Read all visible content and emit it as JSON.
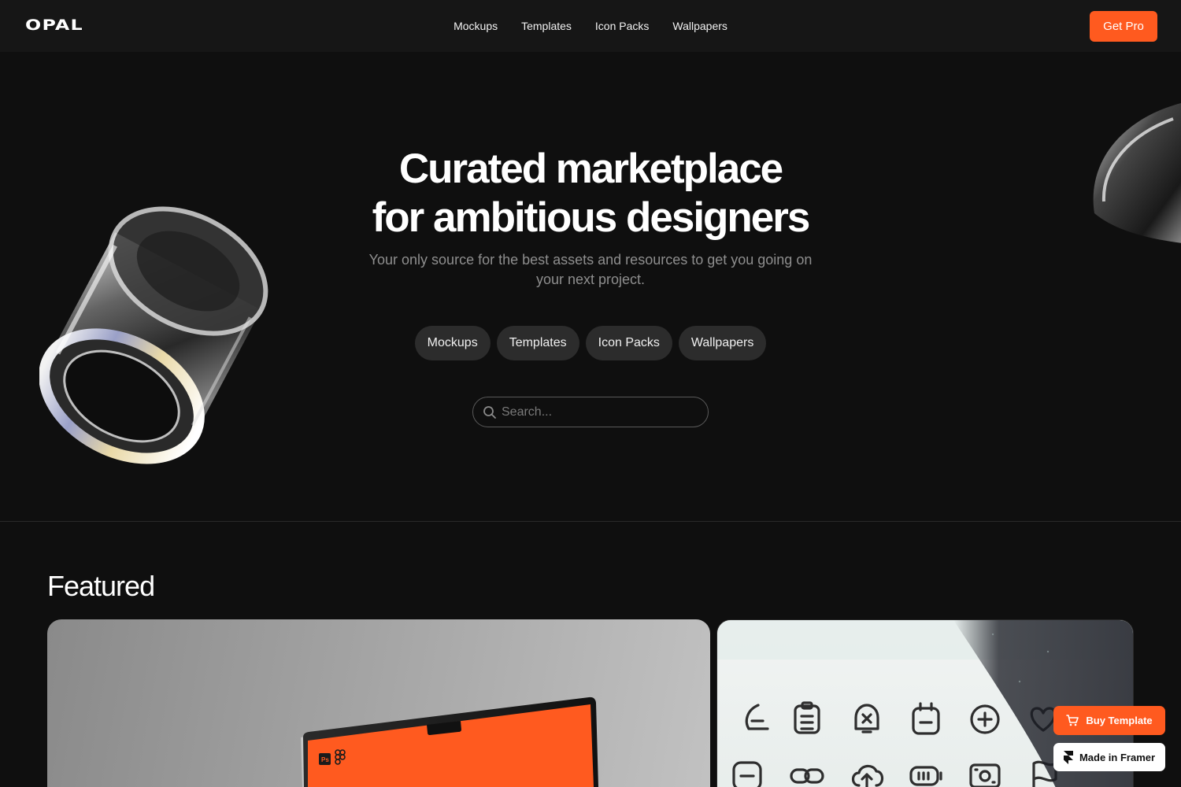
{
  "nav": {
    "logo": "OPAL",
    "links": [
      "Mockups",
      "Templates",
      "Icon Packs",
      "Wallpapers"
    ],
    "cta": "Get Pro"
  },
  "hero": {
    "title_line1": "Curated marketplace",
    "title_line2": "for ambitious designers",
    "subtitle": "Your only source for the best assets and resources to get you going on your next project.",
    "pills": [
      "Mockups",
      "Templates",
      "Icon Packs",
      "Wallpapers"
    ],
    "search_placeholder": "Search..."
  },
  "featured": {
    "heading": "Featured",
    "mockup_card": {
      "app_badges": [
        "Ps",
        "figma-icon"
      ]
    },
    "icon_pack_card": {
      "icons": [
        "pen-nib-icon",
        "clipboard-list-icon",
        "bell-x-icon",
        "calendar-minus-icon",
        "plus-circle-icon",
        "heart-icon",
        "minus-square-icon",
        "link-icon",
        "cloud-upload-icon",
        "battery-icon",
        "banknote-icon",
        "flag-icon"
      ]
    }
  },
  "floating": {
    "buy_template": "Buy Template",
    "made_in_framer": "Made in Framer"
  },
  "colors": {
    "accent": "#ff5a1f",
    "background": "#0f0f0f",
    "nav_background": "#161616",
    "pill_background": "#2c2c2c",
    "muted_text": "#8e8e8e"
  }
}
